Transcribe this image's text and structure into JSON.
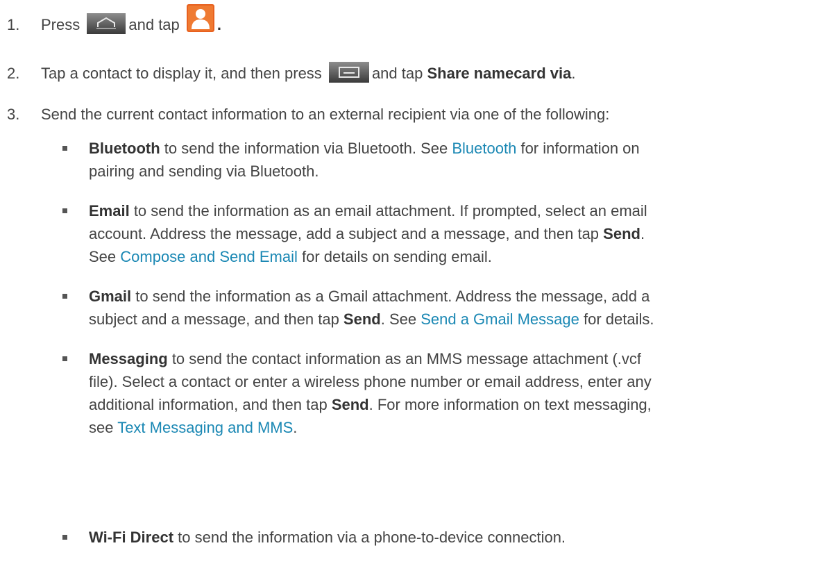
{
  "steps": [
    {
      "number": "1.",
      "press": "Press",
      "and_tap": "and tap",
      "period": ".",
      "home_icon": "home-key-icon",
      "contacts_icon": "contacts-app-icon"
    },
    {
      "number": "2.",
      "text_a": "Tap a contact to display it, and then press",
      "text_b": "and tap",
      "bold": "Share namecard via",
      "period": ".",
      "menu_icon": "menu-key-icon"
    },
    {
      "number": "3.",
      "text": "Send the current contact information to an external recipient via one of the following:"
    }
  ],
  "bullets": {
    "bluetooth": {
      "bold": "Bluetooth",
      "l1a": " to send the information via Bluetooth. See ",
      "link": "Bluetooth",
      "l1b": " for information on",
      "l2": "pairing and sending via Bluetooth."
    },
    "email": {
      "bold": "Email",
      "l1": " to send the information as an email attachment. If prompted, select an email",
      "l2a": "account. Address the message, add a subject and a message, and then tap ",
      "l2bold": "Send",
      "l2b": ".",
      "l3a": "See ",
      "link": "Compose and Send Email",
      "l3b": " for details on sending email."
    },
    "gmail": {
      "bold": "Gmail",
      "l1": " to send the information as a Gmail attachment. Address the message, add a",
      "l2a": "subject and a message, and then tap ",
      "l2bold": "Send",
      "l2b": ". See ",
      "link": "Send a Gmail Message",
      "l2c": " for details."
    },
    "messaging": {
      "bold": "Messaging",
      "l1": " to send the contact information as an MMS message attachment (.vcf",
      "l2": "file). Select a contact or enter a wireless phone number or email address, enter any",
      "l3a": "additional information, and then tap ",
      "l3bold": "Send",
      "l3b": ". For more information on text messaging,",
      "l4a": "see ",
      "link": "Text Messaging and MMS",
      "l4b": "."
    },
    "wifi": {
      "bold": "Wi-Fi Direct",
      "l1": " to send the information via a phone-to-device connection."
    }
  }
}
